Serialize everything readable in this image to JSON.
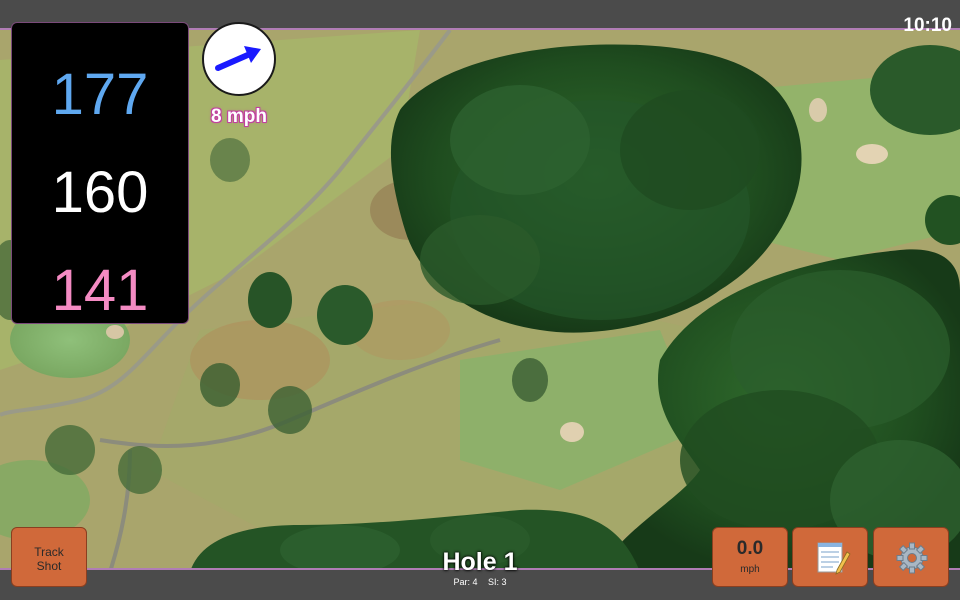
{
  "status": {
    "time": "10:10"
  },
  "distances": {
    "back": "177",
    "middle": "160",
    "front": "141"
  },
  "wind": {
    "speed_label": "8 mph",
    "icon": "wind-arrow-icon",
    "arrow_color": "#1a1aff"
  },
  "hole": {
    "title": "Hole 1",
    "par": "Par: 4",
    "si": "SI: 3"
  },
  "buttons": {
    "track_shot": {
      "line1": "Track",
      "line2": "Shot"
    },
    "speed": {
      "value": "0.0",
      "unit": "mph"
    },
    "notes": {
      "icon": "notepad-icon"
    },
    "settings": {
      "icon": "gear-icon"
    }
  },
  "colors": {
    "back_distance": "#5fa8f0",
    "middle_distance": "#ffffff",
    "front_distance": "#f48bc3",
    "button": "#d0693a",
    "panel": "#000000"
  }
}
